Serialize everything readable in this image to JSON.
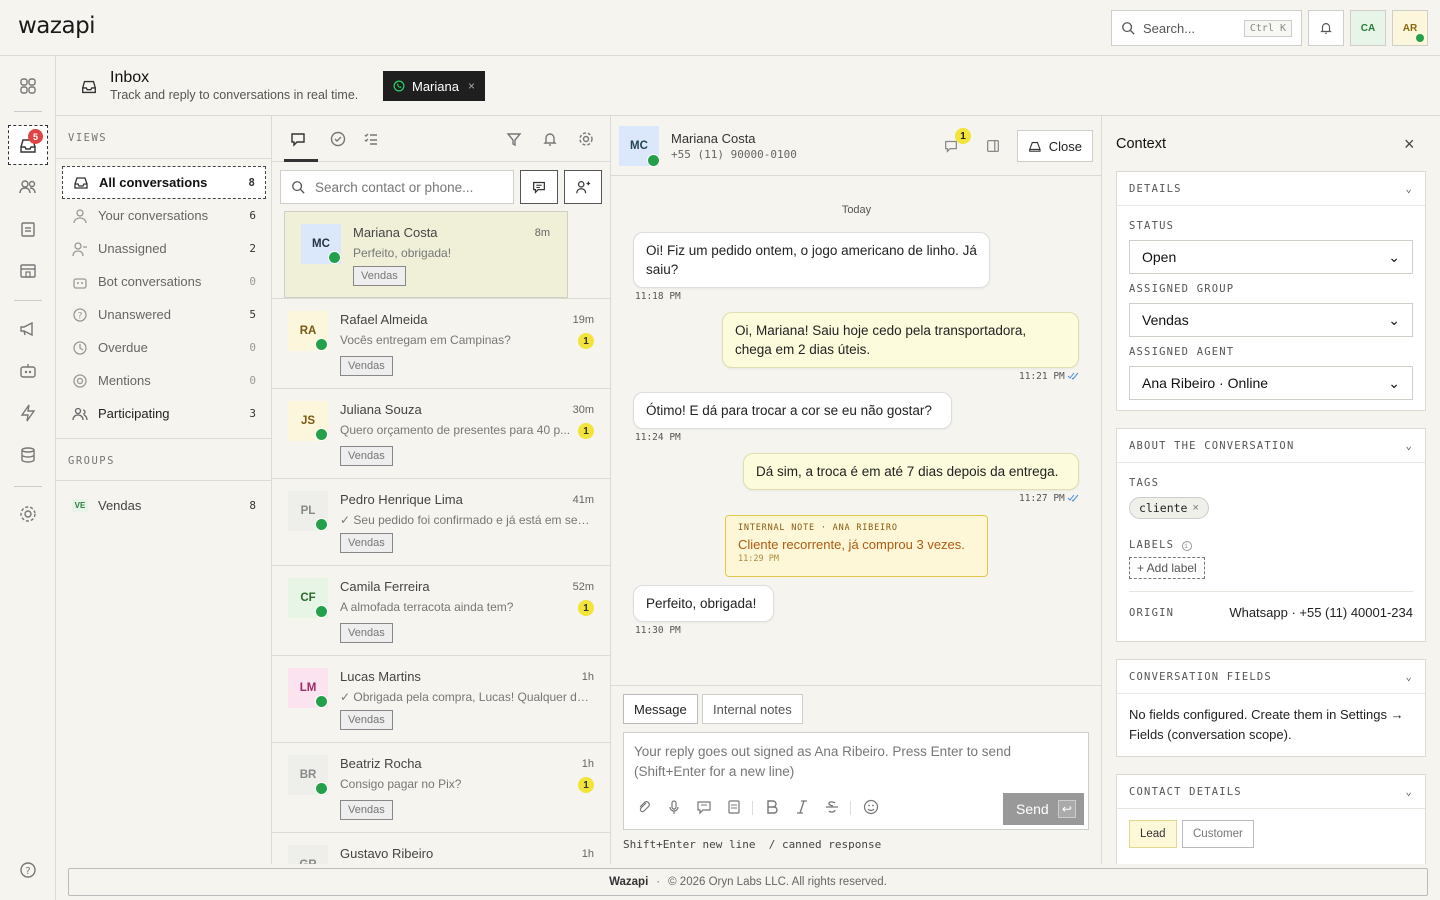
{
  "app": {
    "logo": "wazapi"
  },
  "topbar": {
    "search_label": "Search...",
    "search_kbd": "Ctrl K",
    "user1": "CA",
    "user2": "AR"
  },
  "rail": {
    "inbox_badge": "5"
  },
  "header": {
    "title": "Inbox",
    "subtitle": "Track and reply to conversations in real time.",
    "filter_chip": "Mariana"
  },
  "views": {
    "title": "VIEWS",
    "items": [
      {
        "label": "All conversations",
        "count": "8"
      },
      {
        "label": "Your conversations",
        "count": "6"
      },
      {
        "label": "Unassigned",
        "count": "2"
      },
      {
        "label": "Bot conversations",
        "count": "0"
      },
      {
        "label": "Unanswered",
        "count": "5"
      },
      {
        "label": "Overdue",
        "count": "0"
      },
      {
        "label": "Mentions",
        "count": "0"
      },
      {
        "label": "Participating",
        "count": "3"
      }
    ],
    "groups_title": "GROUPS",
    "groups": [
      {
        "abbr": "VE",
        "label": "Vendas",
        "count": "8"
      }
    ]
  },
  "list": {
    "search_placeholder": "Search contact or phone...",
    "conversations": [
      {
        "initials": "MC",
        "name": "Mariana Costa",
        "time": "8m",
        "preview": "Perfeito, obrigada!",
        "tag": "Vendas",
        "unread": "",
        "avatar_bg": "#dbe7fb",
        "avatar_fg": "#234"
      },
      {
        "initials": "RA",
        "name": "Rafael Almeida",
        "time": "19m",
        "preview": "Vocês entregam em Campinas?",
        "tag": "Vendas",
        "unread": "1",
        "avatar_bg": "#fbf6dc",
        "avatar_fg": "#7a5a10"
      },
      {
        "initials": "JS",
        "name": "Juliana Souza",
        "time": "30m",
        "preview": "Quero orçamento de presentes para 40 p...",
        "tag": "Vendas",
        "unread": "1",
        "avatar_bg": "#fbf6dc",
        "avatar_fg": "#7a5a10"
      },
      {
        "initials": "PL",
        "name": "Pedro Henrique Lima",
        "time": "41m",
        "preview": "✓ Seu pedido foi confirmado e já está em sep...",
        "tag": "Vendas",
        "unread": "",
        "avatar_bg": "#eeeeea",
        "avatar_fg": "#888"
      },
      {
        "initials": "CF",
        "name": "Camila Ferreira",
        "time": "52m",
        "preview": "A almofada terracota ainda tem?",
        "tag": "Vendas",
        "unread": "1",
        "avatar_bg": "#e6f5e6",
        "avatar_fg": "#2a6a2a"
      },
      {
        "initials": "LM",
        "name": "Lucas Martins",
        "time": "1h",
        "preview": "✓ Obrigada pela compra, Lucas! Qualquer dú...",
        "tag": "Vendas",
        "unread": "",
        "avatar_bg": "#fbe3ef",
        "avatar_fg": "#a02a66"
      },
      {
        "initials": "BR",
        "name": "Beatriz Rocha",
        "time": "1h",
        "preview": "Consigo pagar no Pix?",
        "tag": "Vendas",
        "unread": "1",
        "avatar_bg": "#eeeeea",
        "avatar_fg": "#888"
      },
      {
        "initials": "GR",
        "name": "Gustavo Ribeiro",
        "time": "1h",
        "preview": "",
        "tag": "",
        "unread": "",
        "avatar_bg": "#eeeeea",
        "avatar_fg": "#888"
      }
    ]
  },
  "chat": {
    "contact_initials": "MC",
    "contact_name": "Mariana Costa",
    "contact_phone": "+55 (11) 90000-0100",
    "notes_badge": "1",
    "close_label": "Close",
    "day": "Today",
    "messages": [
      {
        "text": "Oi! Fiz um pedido ontem, o jogo americano de linho. Já saiu?",
        "time": "11:18 PM"
      },
      {
        "text": "Oi, Mariana! Saiu hoje cedo pela transportadora, chega em 2 dias úteis.",
        "time": "11:21 PM"
      },
      {
        "text": "Ótimo! E dá para trocar a cor se eu não gostar?",
        "time": "11:24 PM"
      },
      {
        "text": "Dá sim, a troca é em até 7 dias depois da entrega.",
        "time": "11:27 PM"
      },
      {
        "text": "Perfeito, obrigada!",
        "time": "11:30 PM"
      }
    ],
    "note": {
      "label": "INTERNAL NOTE · ANA RIBEIRO",
      "text": "Cliente recorrente, já comprou 3 vezes.",
      "time": "11:29 PM"
    },
    "compose": {
      "tab_message": "Message",
      "tab_notes": "Internal notes",
      "placeholder": "Your reply goes out signed as Ana Ribeiro. Press Enter to send (Shift+Enter for a new line)",
      "send_label": "Send",
      "hint": "Shift+Enter new line  / canned response"
    }
  },
  "context": {
    "title": "Context",
    "details": {
      "header": "DETAILS",
      "status_label": "STATUS",
      "status_value": "Open",
      "group_label": "ASSIGNED GROUP",
      "group_value": "Vendas",
      "agent_label": "ASSIGNED AGENT",
      "agent_value": "Ana Ribeiro · Online"
    },
    "about": {
      "header": "ABOUT THE CONVERSATION",
      "tags_label": "TAGS",
      "tag": "cliente",
      "labels_label": "LABELS",
      "add_label": "+ Add label",
      "origin_label": "ORIGIN",
      "origin_value": "Whatsapp · +55 (11) 40001-234"
    },
    "fields": {
      "header": "CONVERSATION FIELDS",
      "text": "No fields configured. Create them in Settings → Fields (conversation scope)."
    },
    "contact": {
      "header": "CONTACT DETAILS",
      "lead": "Lead",
      "customer": "Customer"
    }
  },
  "footer": {
    "brand": "Wazapi",
    "sep": "·",
    "copyright": "© 2026 Oryn Labs LLC. All rights reserved."
  },
  "colors": {
    "accent_whatsapp": "#25a04a",
    "badge_red": "#e14444",
    "unread_yellow": "#f2e43a",
    "selected_row": "#f0f0d8"
  }
}
